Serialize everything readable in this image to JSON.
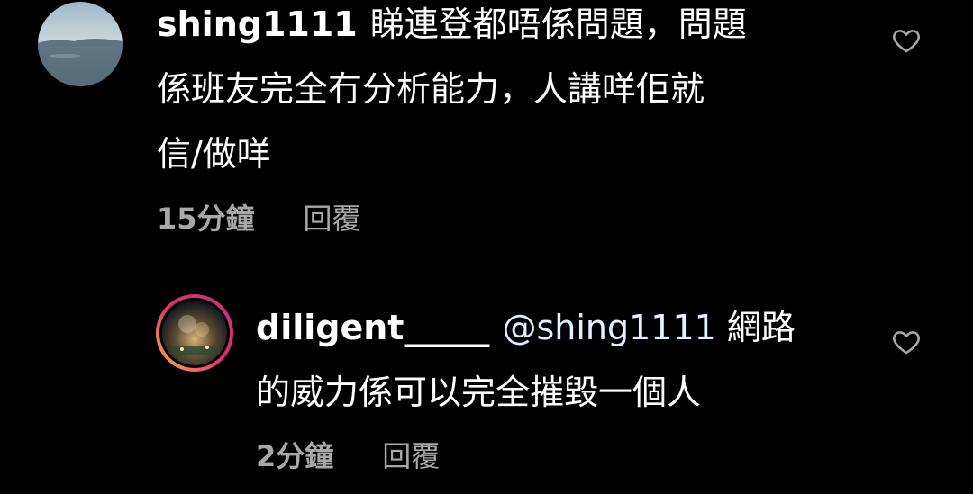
{
  "comments": [
    {
      "username": "shing1111",
      "mention": "",
      "text_line1": "睇連登都唔係問題，問題",
      "text_line2": "係班友完全冇分析能力，人講咩佢就",
      "text_line3": "信/做咩",
      "time": "15分鐘",
      "reply_label": "回覆"
    },
    {
      "username": "diligent_____",
      "mention": "@shing1111",
      "text_line1": "網路",
      "text_line2": "的威力係可以完全摧毀一個人",
      "time": "2分鐘",
      "reply_label": "回覆"
    }
  ],
  "colors": {
    "background": "#000000",
    "text": "#ffffff",
    "meta": "#a8a8a8",
    "mention": "#e0f1ff",
    "story_ring_start": "#fdb44b",
    "story_ring_end": "#c13584"
  },
  "icons": {
    "like": "heart-outline-icon"
  }
}
